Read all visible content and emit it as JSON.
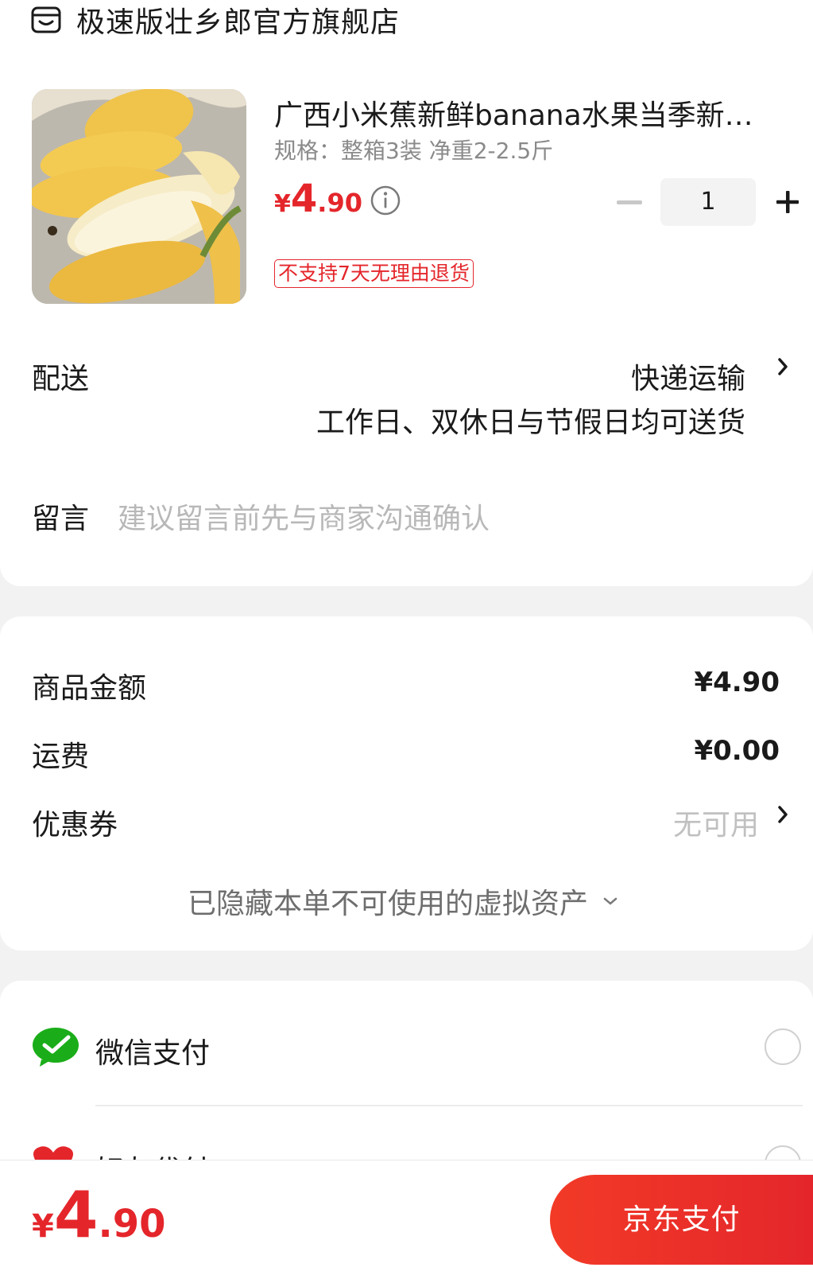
{
  "store": {
    "name": "极速版壮乡郎官方旗舰店",
    "icon": "store-icon"
  },
  "product": {
    "title": "广西小米蕉新鲜banana水果当季新…",
    "spec": "规格：整箱3装 净重2-2.5斤",
    "price_yen": "¥",
    "price_int": "4",
    "price_dec": ".90",
    "quantity": "1",
    "tag": "不支持7天无理由退货"
  },
  "delivery": {
    "label": "配送",
    "method": "快递运输",
    "time": "工作日、双休日与节假日均可送货"
  },
  "note": {
    "label": "留言",
    "placeholder": "建议留言前先与商家沟通确认"
  },
  "summary": {
    "goods_label": "商品金额",
    "goods_value": "¥4.90",
    "shipping_label": "运费",
    "shipping_value": "¥0.00",
    "coupon_label": "优惠券",
    "coupon_value": "无可用",
    "hidden_assets": "已隐藏本单不可使用的虚拟资产"
  },
  "payment": {
    "wechat": "微信支付",
    "friend": "好友代付"
  },
  "footer": {
    "total_yen": "¥",
    "total_int": "4",
    "total_dec": ".90",
    "pay_button": "京东支付"
  },
  "colors": {
    "accent": "#e4262b",
    "wechat": "#1aad19",
    "background": "#f2f2f2"
  }
}
